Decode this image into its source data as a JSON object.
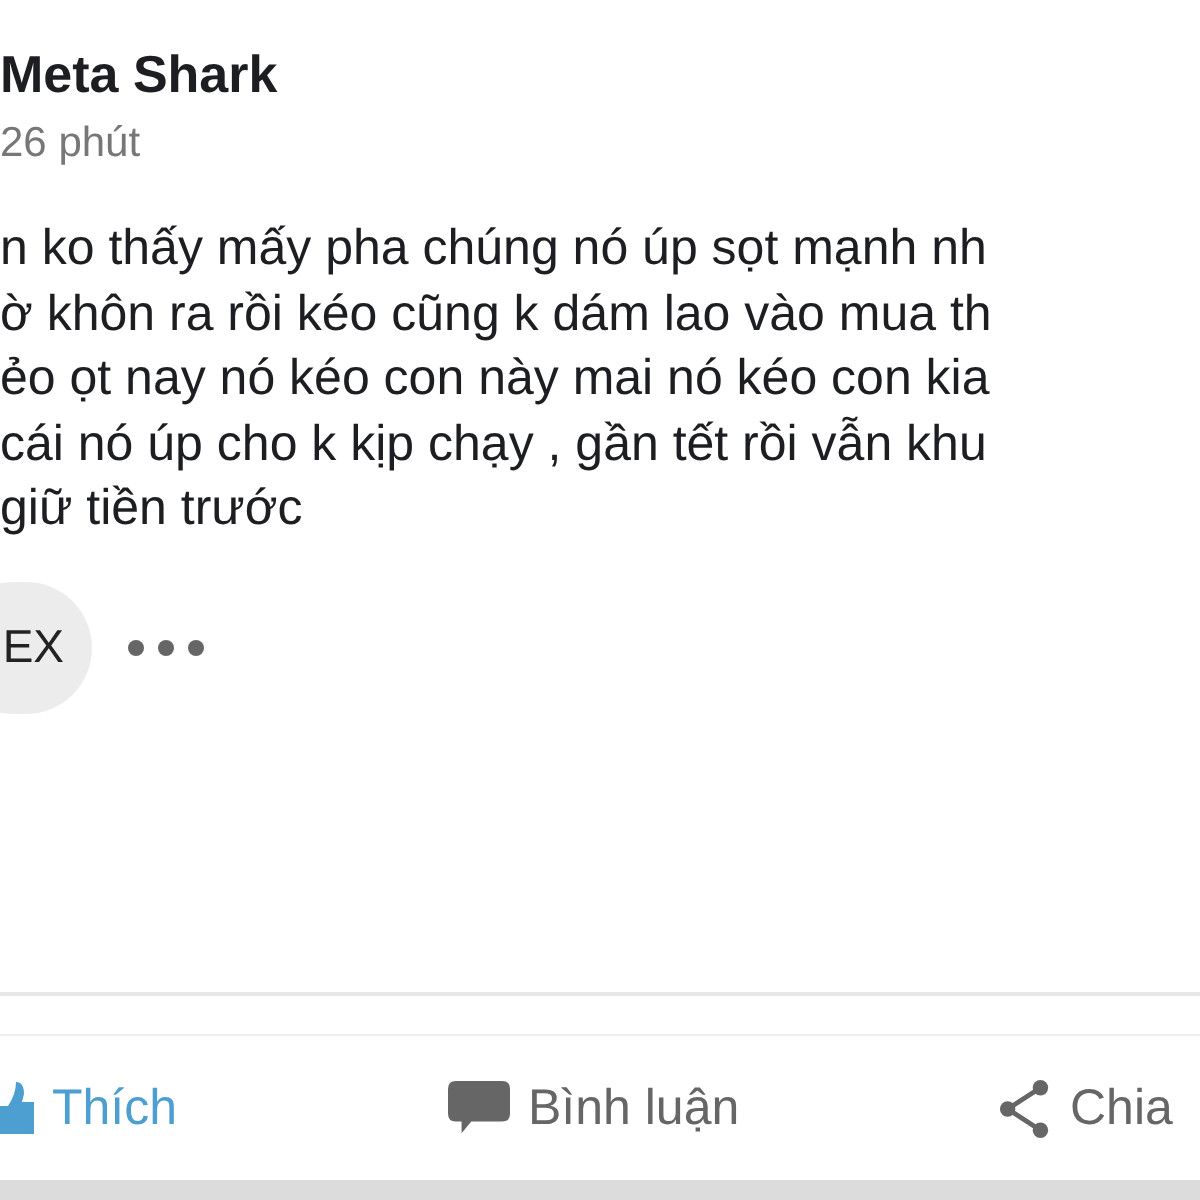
{
  "post": {
    "author": "Meta Shark",
    "time": "26 phút",
    "lines": [
      "n ko thấy mấy pha chúng nó úp sọt mạnh nh",
      "ờ khôn ra rồi kéo cũng k dám lao vào mua th",
      "ẻo ọt nay nó kéo con này mai nó kéo con kia",
      "cái nó úp cho k kịp chạy , gần tết rồi vẫn khu",
      "giữ tiền trước"
    ],
    "chip": "EX"
  },
  "actions": [
    {
      "kind": "like",
      "label": "Thích",
      "selected": true
    },
    {
      "kind": "comment",
      "label": "Bình luận",
      "selected": false
    },
    {
      "kind": "share",
      "label": "Chia",
      "selected": false
    }
  ]
}
